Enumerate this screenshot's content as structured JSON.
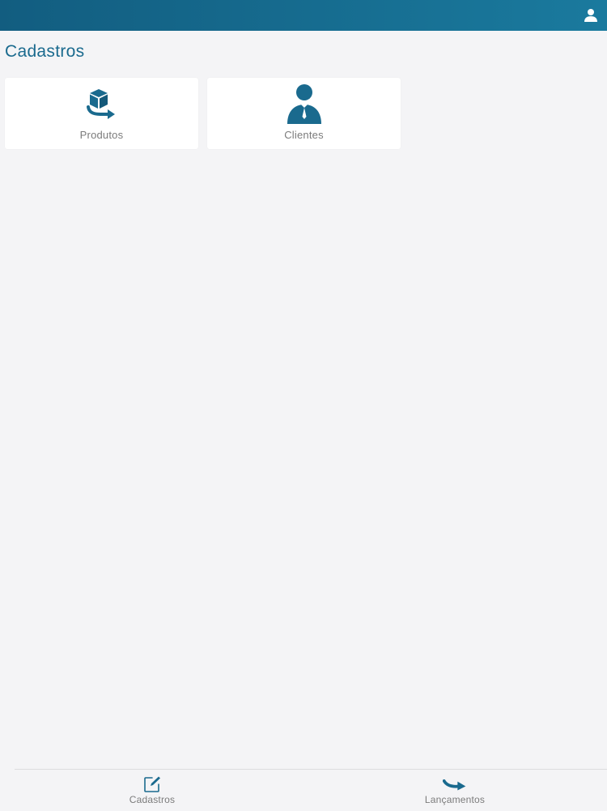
{
  "header": {
    "user_icon": "user-icon",
    "colors": {
      "bar_start": "#125d80",
      "bar_end": "#1a7a9e"
    }
  },
  "page": {
    "title": "Cadastros"
  },
  "cards": [
    {
      "label": "Produtos",
      "icon": "box-arrow-icon"
    },
    {
      "label": "Clientes",
      "icon": "person-tie-icon"
    }
  ],
  "tabbar": {
    "tabs": [
      {
        "label": "Cadastros",
        "icon": "edit-icon"
      },
      {
        "label": "Lançamentos",
        "icon": "arrow-right-curved-icon"
      }
    ]
  },
  "colors": {
    "accent": "#1a6a8e",
    "background": "#f4f4f6",
    "card": "#ffffff",
    "label_gray": "#7b7b7b"
  }
}
